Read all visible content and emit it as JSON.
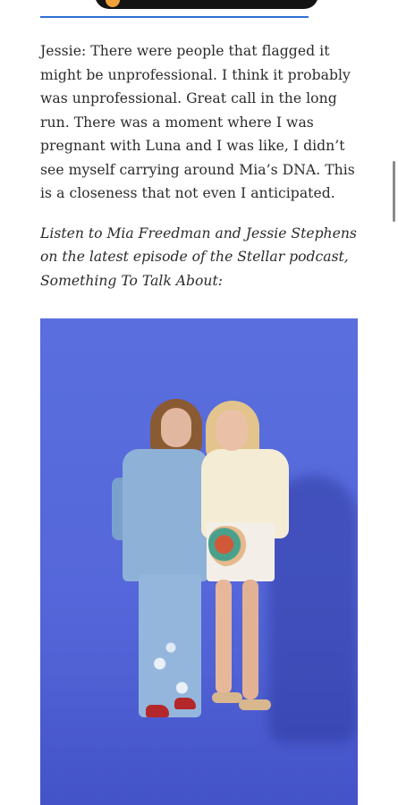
{
  "article": {
    "quote_paragraph": "Jessie: There were people that flagged it might be unprofessional. I think it probably was unprofessional. Great call in the long run. There was a moment where I was pregnant with Luna and I was like, I didn’t see myself carrying around Mia’s DNA. This is a closeness that not even I anticipated.",
    "podcast_caption": "Listen to Mia Freedman and Jessie Stephens on the latest episode of the Stellar podcast, Something To Talk About:"
  },
  "colors": {
    "divider_accent": "#2f6fd6",
    "photo_backdrop": "#5567da",
    "player_background": "#141414",
    "player_icon": "#f2a23a"
  },
  "icons": {
    "player_play": "play-icon"
  }
}
